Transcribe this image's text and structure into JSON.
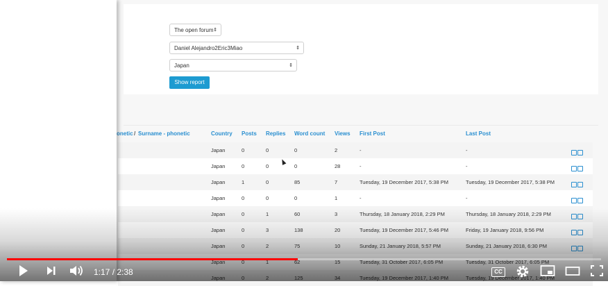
{
  "form": {
    "forum_select": "The open forum",
    "user_select": "Daniel Alejandro2Eric3Miao",
    "country_select": "Japan",
    "show_report_button": "Show report"
  },
  "table": {
    "headers": {
      "name_partial": "onetic",
      "name_sep": "/",
      "surname": "Surname - phonetic",
      "country": "Country",
      "posts": "Posts",
      "replies": "Replies",
      "word_count": "Word count",
      "views": "Views",
      "first_post": "First Post",
      "last_post": "Last Post"
    },
    "rows": [
      {
        "country": "Japan",
        "posts": "0",
        "replies": "0",
        "words": "0",
        "views": "2",
        "first": "-",
        "last": "-"
      },
      {
        "country": "Japan",
        "posts": "0",
        "replies": "0",
        "words": "0",
        "views": "28",
        "first": "-",
        "last": "-"
      },
      {
        "country": "Japan",
        "posts": "1",
        "replies": "0",
        "words": "85",
        "views": "7",
        "first": "Tuesday, 19 December 2017, 5:38 PM",
        "last": "Tuesday, 19 December 2017, 5:38 PM"
      },
      {
        "country": "Japan",
        "posts": "0",
        "replies": "0",
        "words": "0",
        "views": "1",
        "first": "-",
        "last": "-"
      },
      {
        "country": "Japan",
        "posts": "0",
        "replies": "1",
        "words": "60",
        "views": "3",
        "first": "Thursday, 18 January 2018, 2:29 PM",
        "last": "Thursday, 18 January 2018, 2:29 PM"
      },
      {
        "country": "Japan",
        "posts": "0",
        "replies": "3",
        "words": "138",
        "views": "20",
        "first": "Tuesday, 19 December 2017, 5:46 PM",
        "last": "Friday, 19 January 2018, 9:56 PM"
      },
      {
        "country": "Japan",
        "posts": "0",
        "replies": "2",
        "words": "75",
        "views": "10",
        "first": "Sunday, 21 January 2018, 5:57 PM",
        "last": "Sunday, 21 January 2018, 6:30 PM"
      },
      {
        "country": "Japan",
        "posts": "0",
        "replies": "1",
        "words": "62",
        "views": "15",
        "first": "Tuesday, 31 October 2017, 6:05 PM",
        "last": "Tuesday, 31 October 2017, 6:05 PM"
      },
      {
        "country": "Japan",
        "posts": "0",
        "replies": "2",
        "words": "125",
        "views": "34",
        "first": "Tuesday, 19 December 2017, 1:40 PM",
        "last": "Tuesday, 19 December 2017, 1:40 PM"
      }
    ]
  },
  "player": {
    "time": "1:17 / 2:38",
    "progress": 0.49,
    "accent": "#ff0000",
    "icons": [
      "play-icon",
      "next-icon",
      "volume-icon",
      "captions-icon",
      "settings-icon",
      "miniplayer-icon",
      "theater-icon",
      "fullscreen-icon"
    ],
    "cc_label": "CC"
  }
}
